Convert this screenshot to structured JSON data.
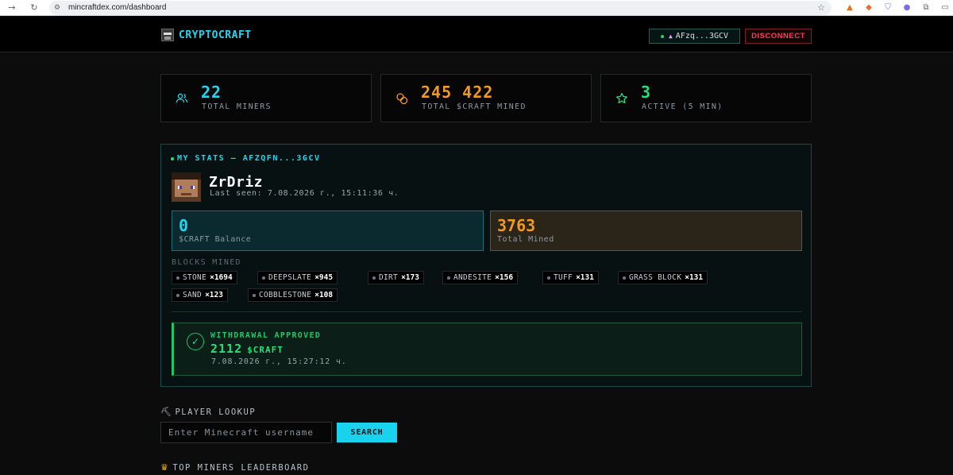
{
  "browser": {
    "url": "mincraftdex.com/dashboard"
  },
  "header": {
    "brand": "CRYPTOCRAFT",
    "wallet": "AFzq...3GCV",
    "disconnect_label": "DISCONNECT"
  },
  "stats": [
    {
      "value": "22",
      "label": "TOTAL MINERS",
      "icon": "users-icon",
      "color": "#1fd6ee"
    },
    {
      "value": "245 422",
      "label": "TOTAL $CRAFT MINED",
      "icon": "coins-icon",
      "color": "#f29a20"
    },
    {
      "value": "3",
      "label": "ACTIVE (5 MIN)",
      "icon": "star-icon",
      "color": "#22e07a"
    }
  ],
  "my_stats": {
    "title": "MY STATS — AFZQFN...3GCV",
    "player_name": "ZrDriz",
    "last_seen": "Last seen: 7.08.2026 г., 15:11:36 ч.",
    "balance_value": "0",
    "balance_label": "$CRAFT Balance",
    "mined_value": "3763",
    "mined_label": "Total Mined",
    "blocks_title": "BLOCKS MINED",
    "blocks": [
      {
        "name": "STONE",
        "count": "×1694"
      },
      {
        "name": "DEEPSLATE",
        "count": "×945"
      },
      {
        "name": "DIRT",
        "count": "×173"
      },
      {
        "name": "ANDESITE",
        "count": "×156"
      },
      {
        "name": "TUFF",
        "count": "×131"
      },
      {
        "name": "GRASS BLOCK",
        "count": "×131"
      },
      {
        "name": "SAND",
        "count": "×123"
      },
      {
        "name": "COBBLESTONE",
        "count": "×108"
      }
    ],
    "withdrawal": {
      "status": "WITHDRAWAL APPROVED",
      "amount": "2112",
      "currency": "$CRAFT",
      "date": "7.08.2026 г., 15:27:12 ч."
    }
  },
  "lookup": {
    "title": "PLAYER LOOKUP",
    "placeholder": "Enter Minecraft username",
    "button": "SEARCH"
  },
  "leaderboard": {
    "title": "TOP MINERS LEADERBOARD"
  },
  "colors": {
    "accent_cyan": "#1fd6ee",
    "accent_orange": "#f29a20",
    "accent_green": "#22e07a",
    "danger": "#ff3b55"
  }
}
